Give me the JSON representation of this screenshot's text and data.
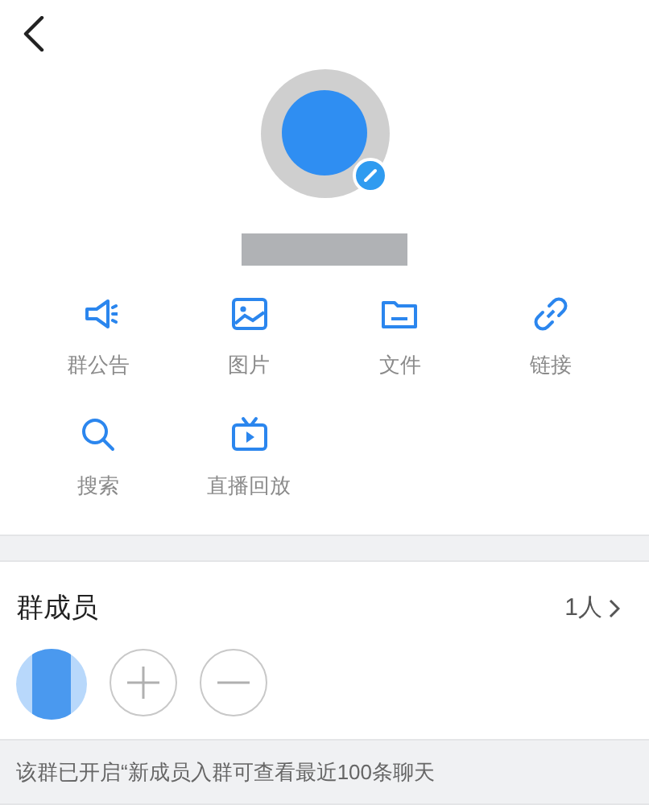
{
  "actions": [
    {
      "kind": "announcement",
      "label": "群公告"
    },
    {
      "kind": "picture",
      "label": "图片"
    },
    {
      "kind": "file",
      "label": "文件"
    },
    {
      "kind": "link",
      "label": "链接"
    },
    {
      "kind": "search",
      "label": "搜索"
    },
    {
      "kind": "replay",
      "label": "直播回放"
    }
  ],
  "members": {
    "title": "群成员",
    "count": "1人",
    "buttons": [
      {
        "kind": "add"
      },
      {
        "kind": "remove"
      }
    ]
  },
  "notice": "该群已开启“新成员入群可查看最近100条聊天"
}
